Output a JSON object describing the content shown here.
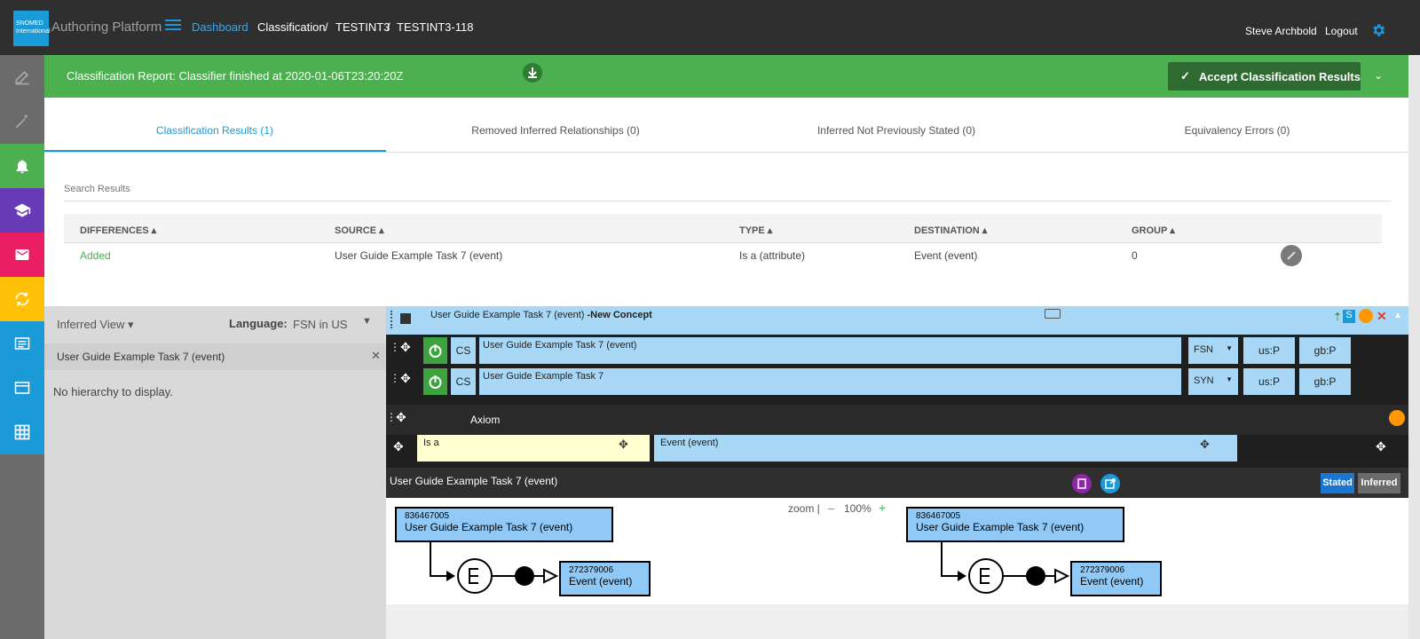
{
  "header": {
    "logo_text": "SNOMED International",
    "app_title": "Authoring Platform",
    "breadcrumbs": [
      "Dashboard",
      "Classification",
      "/",
      "TESTINT3",
      "/",
      "TESTINT3-118"
    ],
    "user_name": "Steve Archbold",
    "logout_label": "Logout"
  },
  "rail": {
    "items": [
      {
        "icon": "edit-icon",
        "color": "#6b6b6b"
      },
      {
        "icon": "wand-icon",
        "color": "#6b6b6b"
      },
      {
        "icon": "bell-icon",
        "color": "#4caf50"
      },
      {
        "icon": "graduation-cap-icon",
        "color": "#673ab7"
      },
      {
        "icon": "mail-icon",
        "color": "#e91e63"
      },
      {
        "icon": "sync-icon",
        "color": "#ffc107"
      },
      {
        "icon": "list-icon",
        "color": "#1a9ad7"
      },
      {
        "icon": "card-icon",
        "color": "#1a9ad7"
      },
      {
        "icon": "grid-icon",
        "color": "#1a9ad7"
      }
    ]
  },
  "banner": {
    "text": "Classification Report: Classifier finished at 2020-01-06T23:20:20Z",
    "accept_label": "Accept Classification Results",
    "color": "#4caf50"
  },
  "tabs": [
    {
      "label": "Classification Results (1)",
      "active": true
    },
    {
      "label": "Removed Inferred Relationships (0)",
      "active": false
    },
    {
      "label": "Inferred Not Previously Stated (0)",
      "active": false
    },
    {
      "label": "Equivalency Errors (0)",
      "active": false
    }
  ],
  "search": {
    "placeholder": "Search Results"
  },
  "table": {
    "columns": [
      "DIFFERENCES",
      "SOURCE",
      "TYPE",
      "DESTINATION",
      "GROUP"
    ],
    "rows": [
      {
        "difference": "Added",
        "source": "User Guide Example Task 7 (event)",
        "type": "Is a (attribute)",
        "destination": "Event (event)",
        "group": "0"
      }
    ]
  },
  "left_panel": {
    "view_label": "Inferred View",
    "language_label": "Language:",
    "language_value": "FSN in US",
    "concept_label": "User Guide Example Task 7 (event)",
    "empty_message": "No hierarchy to display."
  },
  "editor": {
    "title": "User Guide Example Task 7 (event)",
    "title_suffix": "-New Concept",
    "descriptions": [
      {
        "cs": "CS",
        "term": "User Guide Example Task 7 (event)",
        "type": "FSN",
        "us": "us:P",
        "gb": "gb:P"
      },
      {
        "cs": "CS",
        "term": "User Guide Example Task 7",
        "type": "SYN",
        "us": "us:P",
        "gb": "gb:P"
      }
    ],
    "axiom_label": "Axiom",
    "relationship": {
      "type": "Is a",
      "target": "Event (event)"
    }
  },
  "diagram": {
    "title": "User Guide Example Task 7 (event)",
    "zoom_label": "zoom |",
    "zoom_minus": "–",
    "zoom_value": "100%",
    "zoom_plus": "+",
    "stated_label": "Stated",
    "inferred_label": "Inferred",
    "stated_view": {
      "concept_id": "836467005",
      "concept_label": "User Guide Example Task 7 (event)",
      "parent_id": "272379006",
      "parent_label": "Event (event)"
    },
    "inferred_view": {
      "concept_id": "836467005",
      "concept_label": "User Guide Example Task 7 (event)",
      "parent_id": "272379006",
      "parent_label": "Event (event)"
    }
  },
  "colors": {
    "accent": "#1a9ad7",
    "header_bg": "#2f2f2f",
    "editor_blue": "#a8d8f5",
    "diagram_node": "#90c9f5",
    "added_green": "#4caf50",
    "orange_dot": "#ff9800"
  }
}
